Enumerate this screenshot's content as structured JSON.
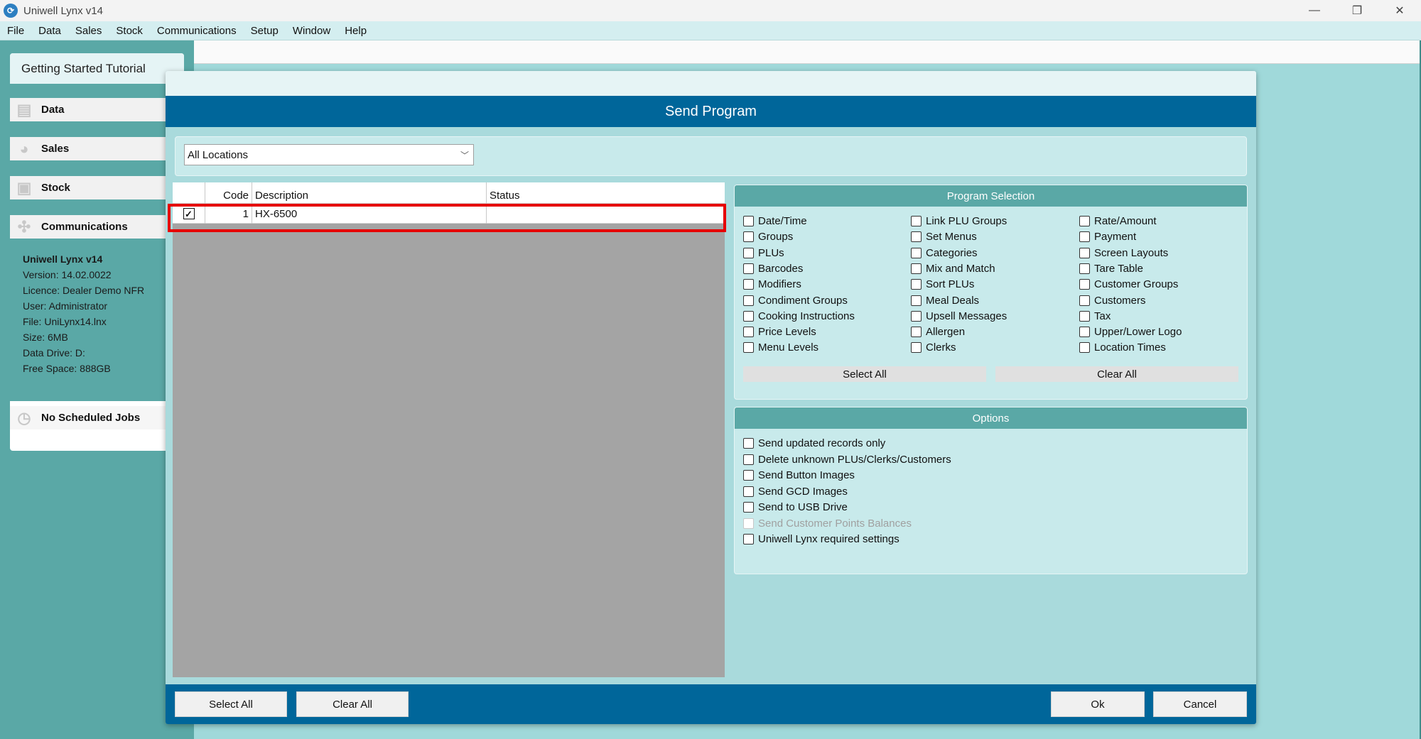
{
  "window": {
    "title": "Uniwell Lynx v14",
    "controls": [
      "—",
      "❐",
      "✕"
    ]
  },
  "menu": [
    "File",
    "Data",
    "Sales",
    "Stock",
    "Communications",
    "Setup",
    "Window",
    "Help"
  ],
  "leftnav": {
    "title": "Getting Started Tutorial",
    "items": [
      {
        "label": "Data",
        "icon": "data-icon"
      },
      {
        "label": "Sales",
        "icon": "pie-chart-icon"
      },
      {
        "label": "Stock",
        "icon": "box-icon"
      },
      {
        "label": "Communications",
        "icon": "network-icon"
      }
    ],
    "info": {
      "title": "Uniwell Lynx v14",
      "version": "Version: 14.02.0022",
      "licence": "Licence: Dealer Demo NFR",
      "user": "User: Administrator",
      "file": "File: UniLynx14.lnx",
      "size": "Size: 6MB",
      "data_drive": "Data Drive: D:",
      "free_space": "Free Space: 888GB"
    },
    "scheduled": "No Scheduled Jobs"
  },
  "dialog": {
    "title": "Send Program",
    "location": "All Locations",
    "grid": {
      "columns": [
        "",
        "Code",
        "Description",
        "Status"
      ],
      "rows": [
        {
          "checked": true,
          "code": "1",
          "description": "HX-6500",
          "status": ""
        }
      ]
    },
    "program_selection": {
      "title": "Program Selection",
      "col1": [
        "Date/Time",
        "Groups",
        "PLUs",
        "Barcodes",
        "Modifiers",
        "Condiment Groups",
        "Cooking Instructions",
        "Price Levels",
        "Menu Levels"
      ],
      "col2": [
        "Link PLU Groups",
        "Set Menus",
        "Categories",
        "Mix and Match",
        "Sort PLUs",
        "Meal Deals",
        "Upsell Messages",
        "Allergen",
        "Clerks"
      ],
      "col3": [
        "Rate/Amount",
        "Payment",
        "Screen Layouts",
        "Tare Table",
        "Customer Groups",
        "Customers",
        "Tax",
        "Upper/Lower Logo",
        "Location Times"
      ],
      "select_all": "Select All",
      "clear_all": "Clear All"
    },
    "options": {
      "title": "Options",
      "items": [
        {
          "label": "Send updated records only",
          "disabled": false
        },
        {
          "label": "Delete unknown PLUs/Clerks/Customers",
          "disabled": false
        },
        {
          "label": "Send Button Images",
          "disabled": false
        },
        {
          "label": "Send GCD Images",
          "disabled": false
        },
        {
          "label": "Send to USB Drive",
          "disabled": false
        },
        {
          "label": "Send Customer Points Balances",
          "disabled": true
        },
        {
          "label": "Uniwell Lynx required settings",
          "disabled": false
        }
      ]
    },
    "footer": {
      "select_all": "Select All",
      "clear_all": "Clear All",
      "ok": "Ok",
      "cancel": "Cancel"
    }
  },
  "colors": {
    "header_blue": "#00669a",
    "teal": "#5aa8a6",
    "highlight_red": "#e60000"
  }
}
